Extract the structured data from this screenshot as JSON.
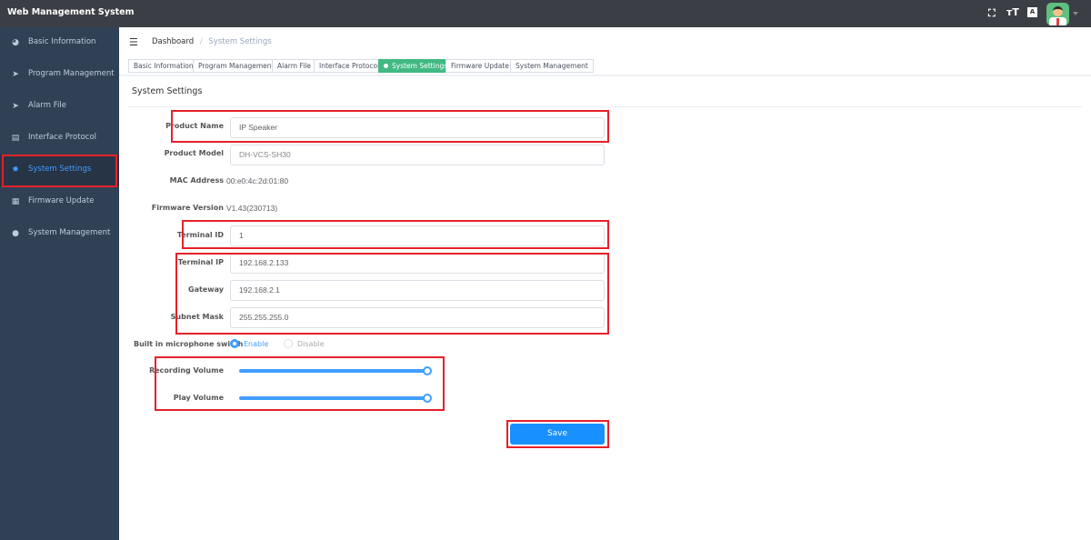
{
  "app_title": "Web Management System",
  "header_icons": [
    "fullscreen-icon",
    "font-size-icon",
    "translate-icon",
    "avatar"
  ],
  "sidebar": {
    "items": [
      {
        "label": "Basic Information",
        "icon": "dashboard-icon"
      },
      {
        "label": "Program Management",
        "icon": "send-icon"
      },
      {
        "label": "Alarm File",
        "icon": "send-icon"
      },
      {
        "label": "Interface Protocol",
        "icon": "document-icon"
      },
      {
        "label": "System Settings",
        "icon": "gear-icon",
        "active": true
      },
      {
        "label": "Firmware Update",
        "icon": "grid-icon"
      },
      {
        "label": "System Management",
        "icon": "globe-icon"
      }
    ]
  },
  "breadcrumb": {
    "home": "Dashboard",
    "sep": "/",
    "current": "System Settings"
  },
  "tabs": [
    "Basic Information",
    "Program Management",
    "Alarm File",
    "Interface Protocol",
    "System Settings",
    "Firmware Update",
    "System Management"
  ],
  "active_tab": "System Settings",
  "section_title": "System Settings",
  "form": {
    "product_name": {
      "label": "Product Name",
      "value": "IP Speaker"
    },
    "product_model": {
      "label": "Product Model",
      "value": "DH-VCS-SH30"
    },
    "mac": {
      "label": "MAC Address",
      "value": "00:e0:4c:2d:01:80"
    },
    "firmware": {
      "label": "Firmware Version",
      "value": "V1.43(230713)"
    },
    "terminal_id": {
      "label": "Terminal ID",
      "value": "1"
    },
    "terminal_ip": {
      "label": "Terminal IP",
      "value": "192.168.2.133"
    },
    "gateway": {
      "label": "Gateway",
      "value": "192.168.2.1"
    },
    "subnet": {
      "label": "Subnet Mask",
      "value": "255.255.255.0"
    },
    "mic": {
      "label": "Built in microphone switch",
      "enable": "Enable",
      "disable": "Disable",
      "selected": "Enable"
    },
    "recording_volume": {
      "label": "Recording Volume",
      "percent": 100
    },
    "play_volume": {
      "label": "Play Volume",
      "percent": 100
    },
    "save": "Save"
  },
  "colors": {
    "accent": "#409eff",
    "active_tab": "#42b983",
    "highlight": "#e6202a",
    "sidebar": "#304156"
  }
}
